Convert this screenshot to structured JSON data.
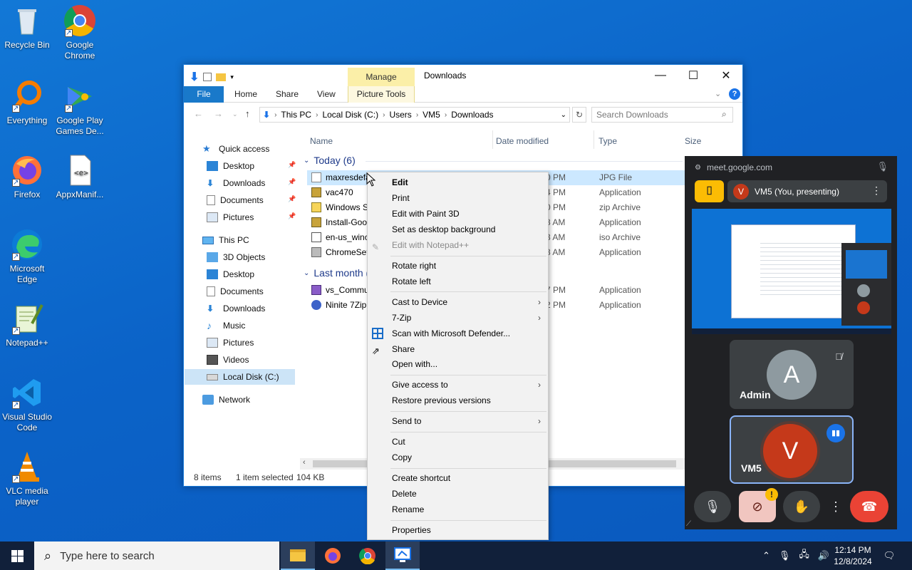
{
  "desktop": {
    "icons": [
      {
        "label": "Recycle Bin"
      },
      {
        "label": "Google Chrome"
      },
      {
        "label": "Everything"
      },
      {
        "label": "Google Play Games De..."
      },
      {
        "label": "Firefox"
      },
      {
        "label": "AppxManif..."
      },
      {
        "label": "Microsoft Edge"
      },
      {
        "label": "Notepad++"
      },
      {
        "label": "Visual Studio Code"
      },
      {
        "label": "VLC media player"
      }
    ]
  },
  "explorer": {
    "title": "Downloads",
    "manage_tab": "Manage",
    "tabs": [
      "File",
      "Home",
      "Share",
      "View",
      "Picture Tools"
    ],
    "breadcrumb": [
      "This PC",
      "Local Disk (C:)",
      "Users",
      "VM5",
      "Downloads"
    ],
    "search_placeholder": "Search Downloads",
    "nav": {
      "quick_access": "Quick access",
      "quick_items": [
        "Desktop",
        "Downloads",
        "Documents",
        "Pictures"
      ],
      "this_pc": "This PC",
      "pc_items": [
        "3D Objects",
        "Desktop",
        "Documents",
        "Downloads",
        "Music",
        "Pictures",
        "Videos",
        "Local Disk (C:)"
      ],
      "network": "Network"
    },
    "columns": [
      "Name",
      "Date modified",
      "Type",
      "Size"
    ],
    "groups": {
      "today": "Today (6)",
      "last_month": "Last month (2)"
    },
    "files_today": [
      {
        "name": "maxresdefault",
        "date": "0 PM",
        "type": "JPG File"
      },
      {
        "name": "vac470",
        "date": "4 PM",
        "type": "Application"
      },
      {
        "name": "Windows S",
        "date": "0 PM",
        "type": "zip Archive"
      },
      {
        "name": "Install-Goo",
        "date": "8 AM",
        "type": "Application"
      },
      {
        "name": "en-us_winc",
        "date": "3 AM",
        "type": "iso Archive"
      },
      {
        "name": "ChromeSet",
        "date": "8 AM",
        "type": "Application"
      }
    ],
    "files_last_month": [
      {
        "name": "vs_Commu",
        "date": "7 PM",
        "type": "Application"
      },
      {
        "name": "Ninite 7Zip",
        "date": "2 PM",
        "type": "Application"
      }
    ],
    "status": {
      "items": "8 items",
      "selected": "1 item selected",
      "size": "104 KB"
    }
  },
  "context_menu": {
    "items": [
      "Edit",
      "Print",
      "Edit with Paint 3D",
      "Set as desktop background",
      "Edit with Notepad++",
      "Rotate right",
      "Rotate left",
      "Cast to Device",
      "7-Zip",
      "Scan with Microsoft Defender...",
      "Share",
      "Open with...",
      "Give access to",
      "Restore previous versions",
      "Send to",
      "Cut",
      "Copy",
      "Create shortcut",
      "Delete",
      "Rename",
      "Properties"
    ]
  },
  "meet": {
    "url": "meet.google.com",
    "presenting": "VM5 (You, presenting)",
    "presenter_initial": "V",
    "participants": [
      {
        "name": "Admin",
        "initial": "A"
      },
      {
        "name": "VM5",
        "initial": "V"
      }
    ],
    "colors": {
      "end_call": "#ea4335",
      "avatar_a": "#8e9aa0",
      "avatar_v": "#c5391a",
      "accent": "#8ab4f8"
    }
  },
  "taskbar": {
    "search_placeholder": "Type here to search",
    "time": "12:14 PM",
    "date": "12/8/2024"
  }
}
